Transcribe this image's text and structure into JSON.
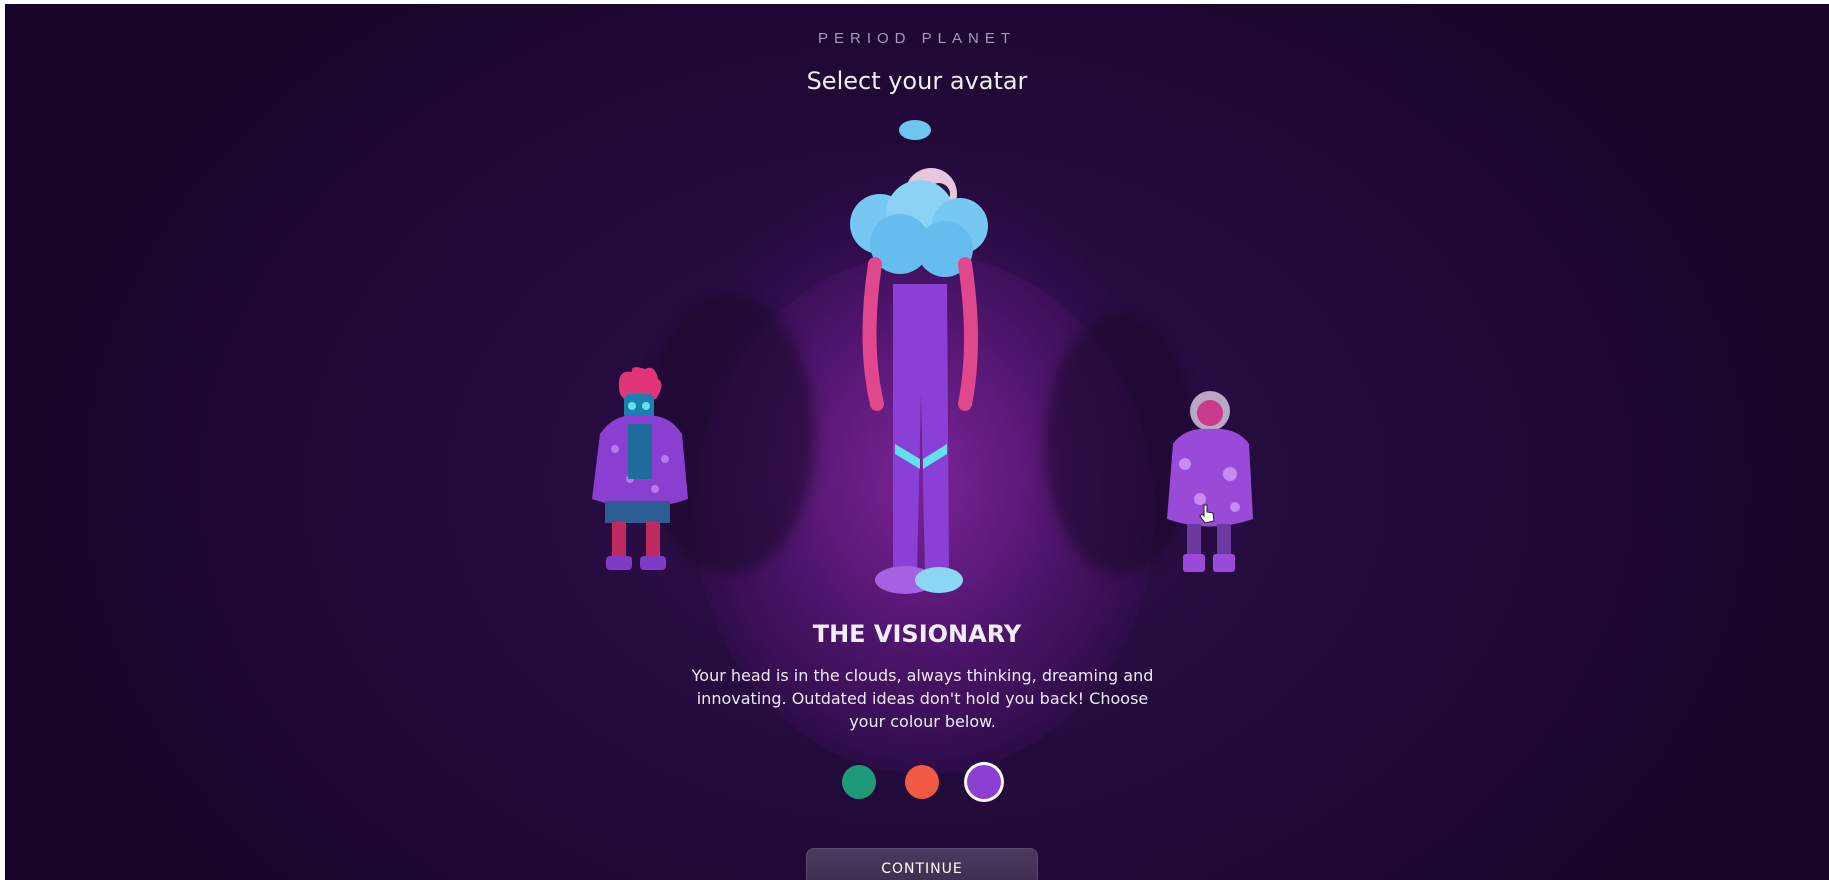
{
  "app": {
    "brand": "PERIOD PLANET",
    "heading": "Select your avatar"
  },
  "avatar": {
    "name": "THE VISIONARY",
    "description": "Your head is in the clouds, always thinking, dreaming and innovating. Outdated ideas don't hold you back! Choose your colour below.",
    "left_character_icon": "avatar-spiky-hair-icon",
    "center_character_icon": "avatar-cloud-head-icon",
    "right_character_icon": "avatar-astronaut-icon"
  },
  "colours": {
    "options": [
      "#1e9a78",
      "#f05a45",
      "#8c3fd0"
    ],
    "selected_index": 2
  },
  "actions": {
    "continue_label": "CONTINUE"
  }
}
